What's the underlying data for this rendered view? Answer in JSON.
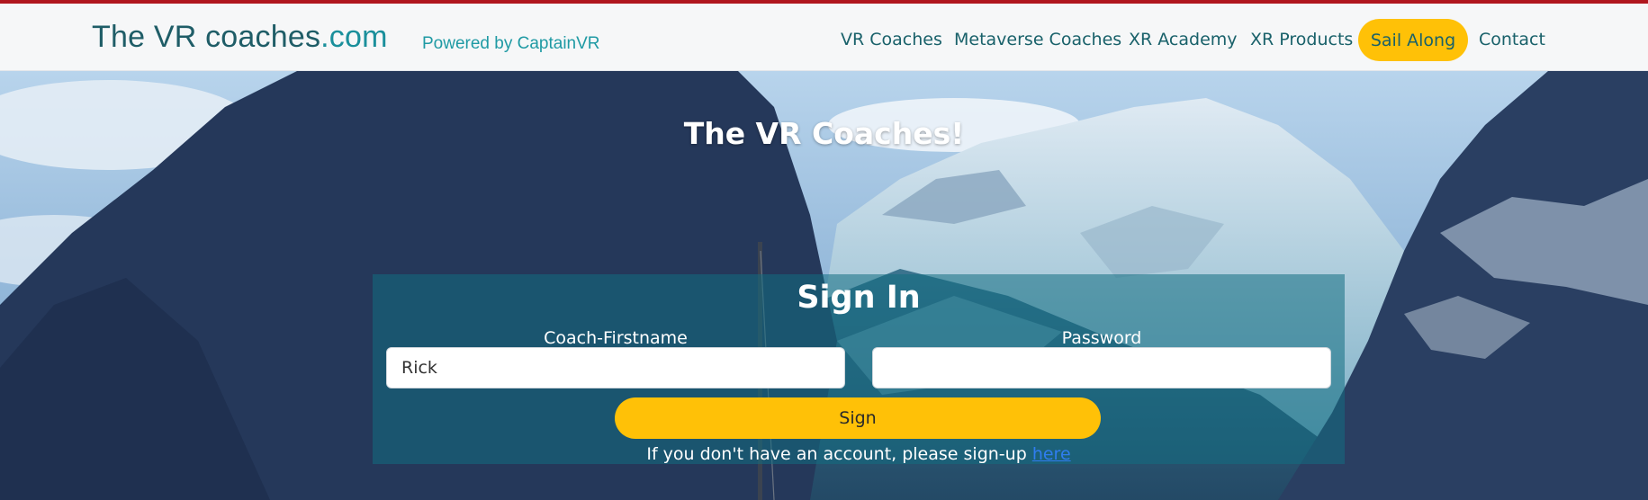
{
  "header": {
    "brand_main": "The VR coaches",
    "brand_tld": ".com",
    "powered_by": "Powered by CaptainVR"
  },
  "nav": {
    "items": [
      {
        "label": "VR Coaches"
      },
      {
        "label": "Metaverse Coaches"
      },
      {
        "label": "XR Academy"
      },
      {
        "label": "XR Products"
      },
      {
        "label": "Sail Along",
        "highlighted": true
      },
      {
        "label": "Contact"
      }
    ]
  },
  "hero": {
    "title": "The VR Coaches!"
  },
  "signin": {
    "title": "Sign In",
    "firstname_label": "Coach-Firstname",
    "firstname_value": "Rick",
    "password_label": "Password",
    "password_value": "",
    "button_label": "Sign",
    "signup_prefix": "If you don't have an account, please sign-up ",
    "signup_link": "here"
  },
  "colors": {
    "top_accent": "#b0161e",
    "brand": "#1f5d67",
    "nav_text": "#19616a",
    "highlight": "#ffc107",
    "panel": "rgba(18,110,130,0.55)",
    "link": "#2f7df0"
  }
}
